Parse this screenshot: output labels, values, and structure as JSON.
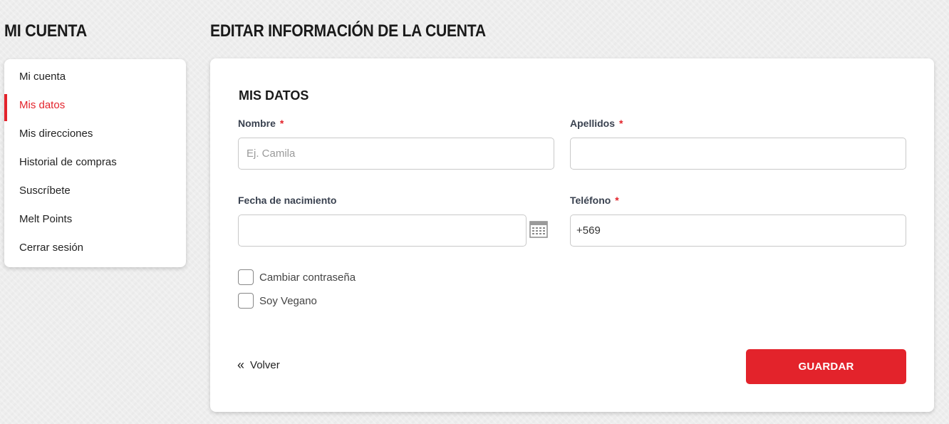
{
  "sidebar": {
    "title": "MI CUENTA",
    "items": [
      {
        "label": "Mi cuenta"
      },
      {
        "label": "Mis datos"
      },
      {
        "label": "Mis direcciones"
      },
      {
        "label": "Historial de compras"
      },
      {
        "label": "Suscríbete"
      },
      {
        "label": "Melt Points"
      },
      {
        "label": "Cerrar sesión"
      }
    ],
    "active_index": 1
  },
  "main": {
    "title": "EDITAR INFORMACIÓN DE LA CUENTA",
    "section_title": "MIS DATOS",
    "fields": {
      "nombre": {
        "label": "Nombre",
        "required_mark": "*",
        "value": "",
        "placeholder": "Ej. Camila"
      },
      "apellidos": {
        "label": "Apellidos",
        "required_mark": "*",
        "value": ""
      },
      "fecha": {
        "label": "Fecha de nacimiento",
        "value": ""
      },
      "telefono": {
        "label": "Teléfono",
        "required_mark": "*",
        "value": "+569"
      }
    },
    "checkboxes": {
      "cambiar_contrasena": {
        "label": "Cambiar contraseña",
        "checked": false
      },
      "soy_vegano": {
        "label": "Soy Vegano",
        "checked": false
      }
    },
    "back_label": "Volver",
    "save_label": "GUARDAR"
  },
  "icons": {
    "calendar": "calendar-icon",
    "back": "double-chevron-left-icon"
  },
  "colors": {
    "accent": "#e3232b",
    "label": "#3a4250"
  }
}
